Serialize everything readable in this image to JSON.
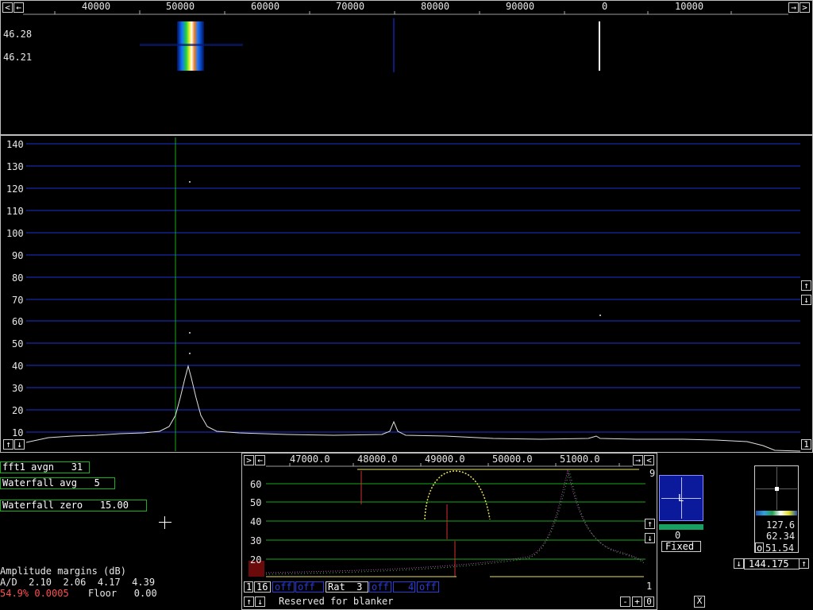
{
  "waterfall": {
    "freq_labels": [
      "40000",
      "50000",
      "60000",
      "70000",
      "80000",
      "90000",
      "0",
      "10000"
    ],
    "time_labels": [
      "46.28",
      "46.21"
    ]
  },
  "spectrum": {
    "y_labels": [
      "140",
      "130",
      "120",
      "110",
      "100",
      "90",
      "80",
      "70",
      "60",
      "50",
      "40",
      "30",
      "20",
      "10"
    ]
  },
  "params": {
    "fft1_avgn": "fft1 avgn   31",
    "waterfall_avg": "Waterfall avg   5",
    "waterfall_zero": "Waterfall zero   15.00",
    "amp_title": "Amplitude margins (dB)",
    "ad_line": "A/D  2.10  2.06  4.17  4.39",
    "stat_pct": "54.9% 0.0005",
    "floor_line": "Floor   0.00"
  },
  "baseband": {
    "freq_labels": [
      "47000.0",
      "48000.0",
      "49000.0",
      "50000.0",
      "51000.0"
    ],
    "y_labels": [
      "60",
      "50",
      "40",
      "30",
      "20"
    ],
    "corner_top": "9",
    "corner_bottom": "1",
    "btn_1": "1",
    "btn_16": "16",
    "off1": "off",
    "off2": "off",
    "rat": "Rat  3",
    "off3": "off",
    "val4": "4",
    "off4": "off",
    "blanker": "Reserved for blanker",
    "minus": "-",
    "plus": "+",
    "zero": "0"
  },
  "agc": {
    "L": "L",
    "value": "0",
    "mode": "Fixed"
  },
  "smeter": {
    "v1": "127.6",
    "v2": "62.34",
    "o": "o",
    "v3": "51.54",
    "freq": "144.175"
  },
  "close": "X",
  "colors": {
    "grid_blue": "#1f2fd0",
    "grid_green": "#18a81a",
    "trace": "#e8e8e8",
    "marker_red": "#d03030"
  }
}
